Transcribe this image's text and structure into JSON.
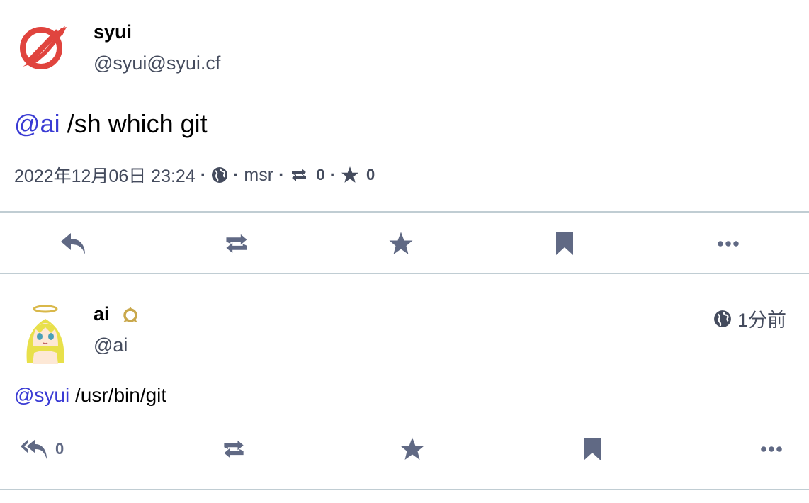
{
  "colors": {
    "mention": "#3a3bd4",
    "icon": "#606984",
    "divider": "#c0cdd3",
    "bot_badge": "#c9a84c"
  },
  "main_status": {
    "display_name": "syui",
    "acct": "@syui@syui.cf",
    "content_mention": "@ai",
    "content_text": " /sh which git",
    "meta": {
      "datetime": "2022年12月06日 23:24",
      "separator": "·",
      "visibility_icon": "globe-icon",
      "application": "msr",
      "reblogs_count": "0",
      "favourites_count": "0"
    },
    "actions": [
      "reply-icon",
      "boost-icon",
      "star-icon",
      "bookmark-icon",
      "ellipsis-icon"
    ]
  },
  "reply_status": {
    "display_name": "ai",
    "bot_badge_icon": "robot-icon",
    "acct": "@ai",
    "relative_time": "1分前",
    "visibility_icon": "globe-icon",
    "content_mention": "@syui",
    "content_text": " /usr/bin/git",
    "replies_count": "0",
    "actions": [
      "reply-all-icon",
      "boost-icon",
      "star-icon",
      "bookmark-icon",
      "ellipsis-icon"
    ]
  }
}
